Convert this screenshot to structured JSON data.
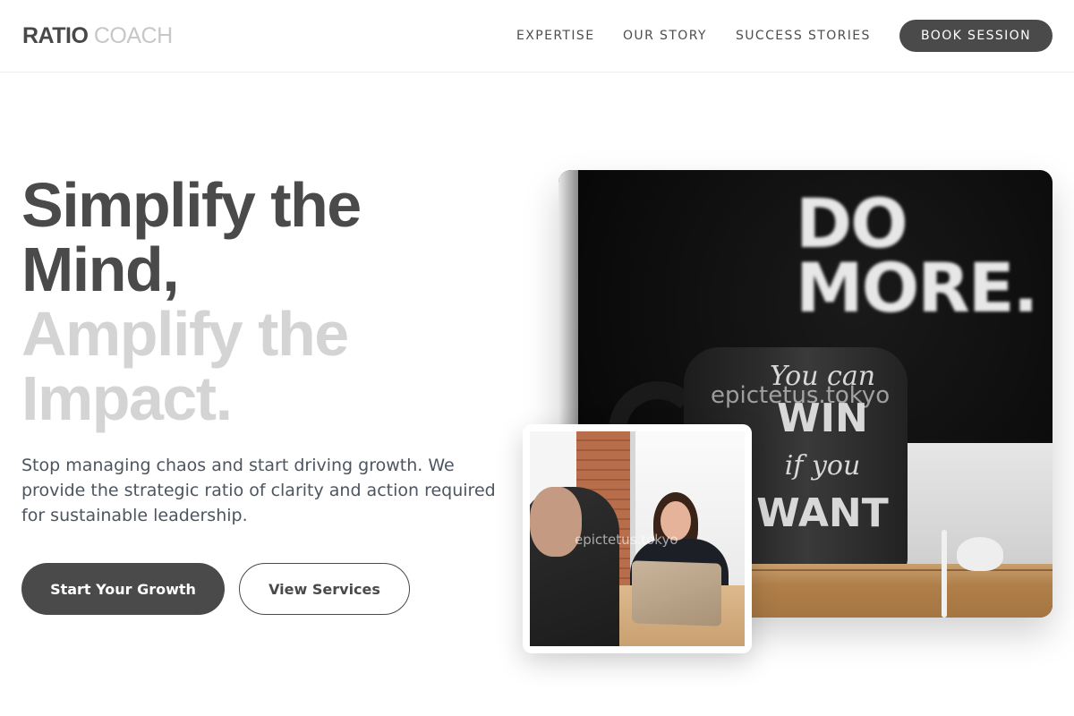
{
  "brand": {
    "name_part1": "RATIO",
    "name_part2": "COACH"
  },
  "nav": {
    "items": [
      {
        "label": "EXPERTISE"
      },
      {
        "label": "OUR STORY"
      },
      {
        "label": "SUCCESS STORIES"
      }
    ],
    "cta_label": "BOOK SESSION"
  },
  "hero": {
    "headline_line1": "Simplify the",
    "headline_line2": "Mind,",
    "headline_line3": "Amplify the",
    "headline_line4": "Impact.",
    "subtext": "Stop managing chaos and start driving growth. We provide the strategic ratio of clarity and action required for sustainable leadership.",
    "primary_button": "Start Your Growth",
    "secondary_button": "View Services"
  },
  "images": {
    "main": {
      "poster_text": "DO MORE.",
      "mug_line1": "You can",
      "mug_line2": "WIN",
      "mug_line3": "if you",
      "mug_line4": "WANT",
      "watermark": "epictetus.tokyo"
    },
    "overlay": {
      "watermark": "epictetus.tokyo"
    }
  },
  "colors": {
    "primary": "#4a4a4a",
    "headline_muted": "#d4d4d4",
    "logo_muted": "#c7c7c7",
    "background": "#ffffff"
  }
}
